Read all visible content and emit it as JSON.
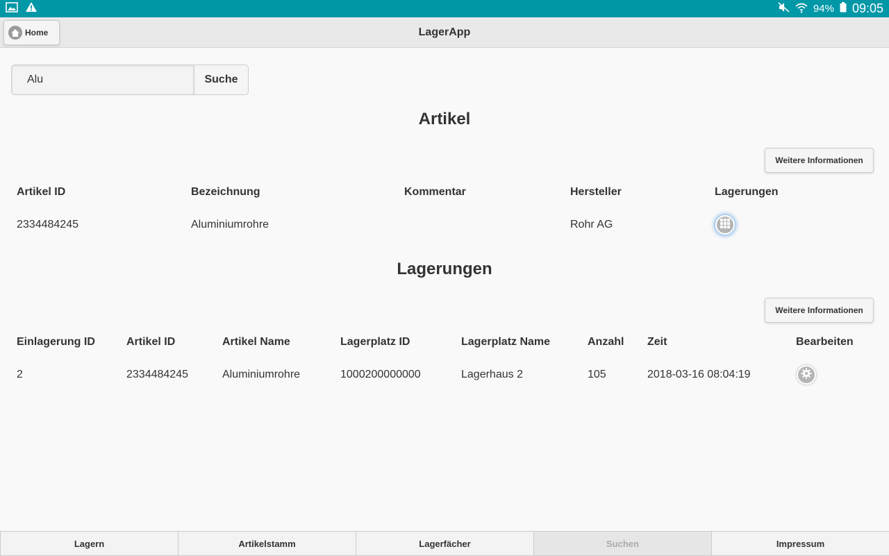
{
  "status_bar": {
    "battery": "94%",
    "time": "09:05",
    "left_icons": [
      "gallery-icon",
      "warning-icon"
    ],
    "right_icons": [
      "mute-icon",
      "wifi-icon",
      "battery-icon"
    ],
    "color": "#0097a7"
  },
  "header": {
    "title": "LagerApp",
    "home_label": "Home"
  },
  "search": {
    "value": "Alu",
    "button_label": "Suche"
  },
  "artikel": {
    "title": "Artikel",
    "info_button": "Weitere Informationen",
    "columns": [
      "Artikel ID",
      "Bezeichnung",
      "Kommentar",
      "Hersteller",
      "Lagerungen"
    ],
    "rows": [
      {
        "artikel_id": "2334484245",
        "bezeichnung": "Aluminiumrohre",
        "kommentar": "",
        "hersteller": "Rohr AG",
        "lagerungen_icon": "grid-icon"
      }
    ]
  },
  "lagerungen": {
    "title": "Lagerungen",
    "info_button": "Weitere Informationen",
    "columns": [
      "Einlagerung ID",
      "Artikel ID",
      "Artikel Name",
      "Lagerplatz ID",
      "Lagerplatz Name",
      "Anzahl",
      "Zeit",
      "Bearbeiten"
    ],
    "rows": [
      {
        "einlagerung_id": "2",
        "artikel_id": "2334484245",
        "artikel_name": "Aluminiumrohre",
        "lagerplatz_id": "1000200000000",
        "lagerplatz_name": "Lagerhaus 2",
        "anzahl": "105",
        "zeit": "2018-03-16 08:04:19",
        "bearbeiten_icon": "gear-icon"
      }
    ]
  },
  "nav": {
    "items": [
      {
        "label": "Lagern",
        "active": false
      },
      {
        "label": "Artikelstamm",
        "active": false
      },
      {
        "label": "Lagerfächer",
        "active": false
      },
      {
        "label": "Suchen",
        "active": true
      },
      {
        "label": "Impressum",
        "active": false
      }
    ]
  }
}
